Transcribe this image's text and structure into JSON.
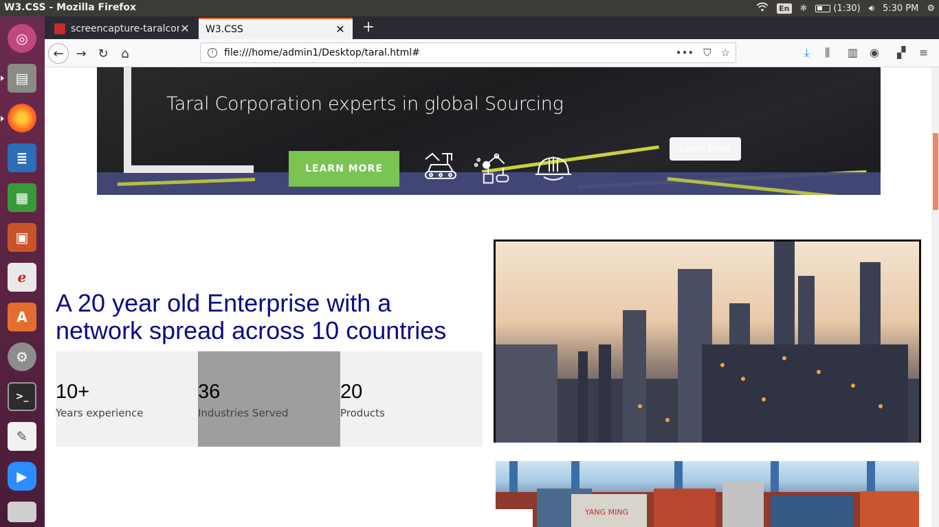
{
  "os": {
    "window_title": "W3.CSS - Mozilla Firefox",
    "tray": {
      "keyboard_layout": "En",
      "battery": "(1:30)",
      "clock": "5:30 PM"
    }
  },
  "browser": {
    "tabs": [
      {
        "label": "screencapture-taralcorp",
        "active": false
      },
      {
        "label": "W3.CSS",
        "active": true
      }
    ],
    "url": "file:///home/admin1/Desktop/taral.html#",
    "url_actions": "•••"
  },
  "hero": {
    "tagline": "Taral Corporation experts in global Sourcing",
    "primary_button": "LEARN MORE",
    "secondary_button": "Learn More",
    "accent_green": "#79c453"
  },
  "about": {
    "headline": "A 20 year old Enterprise with a network spread across 10 countries",
    "headline_color": "#0b0b85",
    "stats": [
      {
        "number": "10+",
        "label": "Years experience",
        "bg": "#f1f1f1"
      },
      {
        "number": "36",
        "label": "Industries Served",
        "bg": "#9e9e9e"
      },
      {
        "number": "20",
        "label": "Products",
        "bg": "#f1f1f1"
      }
    ]
  },
  "images": {
    "container_text": "YANG MING"
  }
}
